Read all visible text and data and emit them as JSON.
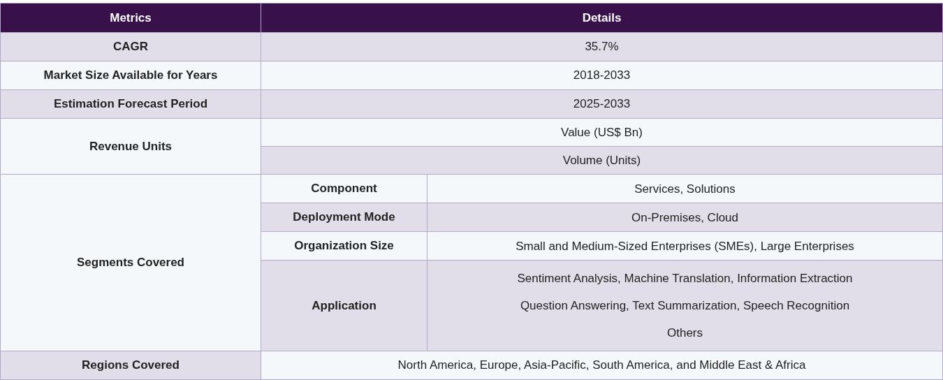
{
  "header": [
    "Metrics",
    "Details"
  ],
  "rows": [
    {
      "kind": "simple",
      "metric": "CAGR",
      "shaded": true,
      "value": "35.7%",
      "value_shaded": true
    },
    {
      "kind": "simple",
      "metric": "Market Size Available for Years",
      "shaded": false,
      "value": "2018-2033",
      "value_shaded": false
    },
    {
      "kind": "simple",
      "metric": "Estimation Forecast Period",
      "shaded": true,
      "value": "2025-2033",
      "value_shaded": true
    },
    {
      "kind": "multi",
      "metric": "Revenue Units",
      "shaded": false,
      "values": [
        {
          "text": "Value (US$ Bn)",
          "shaded": false
        },
        {
          "text": "Volume (Units)",
          "shaded": true
        }
      ]
    },
    {
      "kind": "segments",
      "metric": "Segments Covered",
      "shaded": false,
      "segments": [
        {
          "name": "Component",
          "shaded": false,
          "lines": [
            "Services, Solutions"
          ]
        },
        {
          "name": "Deployment Mode",
          "shaded": true,
          "lines": [
            "On-Premises, Cloud"
          ]
        },
        {
          "name": "Organization Size",
          "shaded": false,
          "lines": [
            "Small and Medium-Sized Enterprises (SMEs), Large Enterprises"
          ]
        },
        {
          "name": "Application",
          "shaded": true,
          "lines": [
            "Sentiment Analysis, Machine Translation, Information Extraction",
            "Question Answering, Text Summarization, Speech Recognition",
            "Others"
          ]
        }
      ]
    },
    {
      "kind": "simple",
      "metric": "Regions Covered",
      "shaded": true,
      "value": "North America, Europe, Asia-Pacific, South America, and Middle East & Africa",
      "value_shaded": false
    }
  ]
}
